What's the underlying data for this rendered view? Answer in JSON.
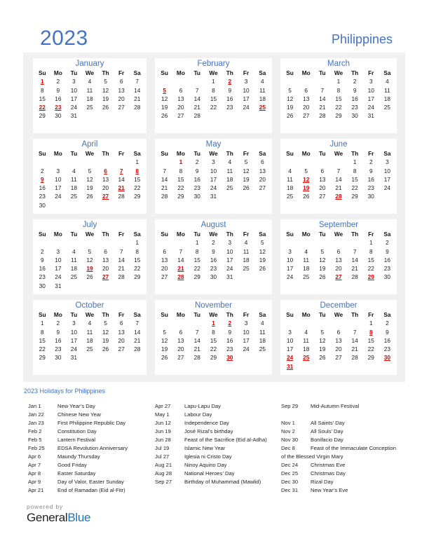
{
  "header": {
    "year": "2023",
    "country": "Philippines"
  },
  "weekdays": [
    "Su",
    "Mo",
    "Tu",
    "We",
    "Th",
    "Fr",
    "Sa"
  ],
  "colors": {
    "accent": "#4472c4",
    "holiday": "#e00000",
    "panel": "#f0f0f0"
  },
  "months": [
    {
      "name": "January",
      "start": 0,
      "days": 31,
      "holidays": [
        1,
        22,
        23
      ]
    },
    {
      "name": "February",
      "start": 3,
      "days": 28,
      "holidays": [
        2,
        5,
        25
      ]
    },
    {
      "name": "March",
      "start": 3,
      "days": 31,
      "holidays": []
    },
    {
      "name": "April",
      "start": 6,
      "days": 30,
      "holidays": [
        6,
        7,
        8,
        9,
        21,
        27
      ]
    },
    {
      "name": "May",
      "start": 1,
      "days": 31,
      "holidays": [
        1
      ],
      "no_underline": [
        1
      ]
    },
    {
      "name": "June",
      "start": 4,
      "days": 30,
      "holidays": [
        12,
        19,
        28
      ]
    },
    {
      "name": "July",
      "start": 6,
      "days": 31,
      "holidays": [
        19,
        27
      ]
    },
    {
      "name": "August",
      "start": 2,
      "days": 31,
      "holidays": [
        21,
        28
      ]
    },
    {
      "name": "September",
      "start": 5,
      "days": 30,
      "holidays": [
        27,
        29
      ]
    },
    {
      "name": "October",
      "start": 0,
      "days": 31,
      "holidays": []
    },
    {
      "name": "November",
      "start": 3,
      "days": 30,
      "holidays": [
        1,
        2,
        30
      ]
    },
    {
      "name": "December",
      "start": 5,
      "days": 31,
      "holidays": [
        8,
        24,
        25,
        30,
        31
      ]
    }
  ],
  "holidays_title": "2023 Holidays for Philippines",
  "holiday_columns": [
    [
      {
        "date": "Jan 1",
        "name": "New Year’s Day"
      },
      {
        "date": "Jan 22",
        "name": "Chinese New Year"
      },
      {
        "date": "Jan 23",
        "name": "First Philippine Republic Day"
      },
      {
        "date": "Feb 2",
        "name": "Constitution Day"
      },
      {
        "date": "Feb 5",
        "name": "Lantern Festival"
      },
      {
        "date": "Feb 25",
        "name": "EDSA Revolution Anniversary"
      },
      {
        "date": "Apr 6",
        "name": "Maundy Thursday"
      },
      {
        "date": "Apr 7",
        "name": "Good Friday"
      },
      {
        "date": "Apr 8",
        "name": "Easter Saturday"
      },
      {
        "date": "Apr 9",
        "name": "Day of Valor, Easter Sunday"
      },
      {
        "date": "Apr 21",
        "name": "End of Ramadan (Eid al-Fitr)"
      }
    ],
    [
      {
        "date": "Apr 27",
        "name": "Lapu-Lapu Day"
      },
      {
        "date": "May 1",
        "name": "Labour Day"
      },
      {
        "date": "Jun 12",
        "name": "Independence Day"
      },
      {
        "date": "Jun 19",
        "name": "José Rizal’s birthday"
      },
      {
        "date": "Jun 28",
        "name": "Feast of the Sacrifice (Eid al-Adha)"
      },
      {
        "date": "Jul 19",
        "name": "Islamic New Year"
      },
      {
        "date": "Jul 27",
        "name": "Iglesia ni Cristo Day"
      },
      {
        "date": "Aug 21",
        "name": "Ninoy Aquino Day"
      },
      {
        "date": "Aug 28",
        "name": "National Heroes’ Day"
      },
      {
        "date": "Sep 27",
        "name": "Birthday of Muhammad (Mawlid)"
      }
    ],
    [
      {
        "date": "Sep 29",
        "name": "Mid-Autumn Festival"
      },
      {
        "date": "",
        "name": ""
      },
      {
        "date": "Nov 1",
        "name": "All Saints’ Day"
      },
      {
        "date": "Nov 2",
        "name": "All Souls’ Day"
      },
      {
        "date": "Nov 30",
        "name": "Bonifacio Day"
      },
      {
        "date": "Dec 8",
        "name": "Feast of the Immaculate Conception"
      },
      {
        "date": "of the Blessed Virgin Mary",
        "name": "",
        "wrap": true
      },
      {
        "date": "Dec 24",
        "name": "Christmas Eve"
      },
      {
        "date": "Dec 25",
        "name": "Christmas Day"
      },
      {
        "date": "Dec 30",
        "name": "Rizal Day"
      },
      {
        "date": "Dec 31",
        "name": "New Year’s Eve"
      }
    ]
  ],
  "footer": {
    "powered_by": "powered by",
    "brand_general": "General",
    "brand_blue": "Blue"
  }
}
